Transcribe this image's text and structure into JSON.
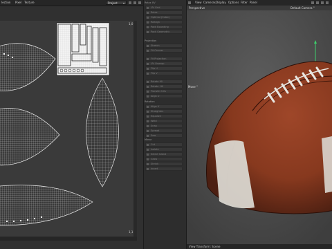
{
  "uv_editor": {
    "menu": [
      "lection",
      "Pixel",
      "Texture"
    ],
    "dropdown_value": "Project",
    "corner_top_label": "1,0",
    "corner_bottom_label": "1,1"
  },
  "tools_panel": {
    "headers": [
      "Relax UV",
      "Projection",
      "Rotation",
      "Mirror"
    ],
    "rows": [
      "UV Grid",
      "Relax",
      "Optimal (Cubic)",
      "Realign",
      "Pack Bounding",
      "Pack Geometric",
      "Stretch",
      "Fit Canvas",
      "Fit Projection",
      "UV Unwrap",
      "Flip U",
      "Flip V",
      "Rotate 90",
      "Rotate -90",
      "Transfer UVs",
      "Align U",
      "Align V",
      "Straighten",
      "Equalize",
      "Weld",
      "Snap",
      "Spread",
      "Sew",
      "Cut",
      "Isolate",
      "Select Island",
      "Grow",
      "Shrink",
      "Invert",
      "Hide",
      "Unhide",
      "Frame",
      "Settings",
      "Apply"
    ]
  },
  "viewport": {
    "menu": [
      "View",
      "Cameras",
      "Display",
      "Options",
      "Filter",
      "Panel"
    ],
    "projection_label": "Perspective",
    "camera_label": "Default Camera °",
    "tool_label": "Move °",
    "status_text": "View Transform: Scene"
  },
  "colors": {
    "ball_leather": "#8a3a1f",
    "ball_stripe": "#d9d6cf",
    "uv_background": "#3a3a3a"
  }
}
